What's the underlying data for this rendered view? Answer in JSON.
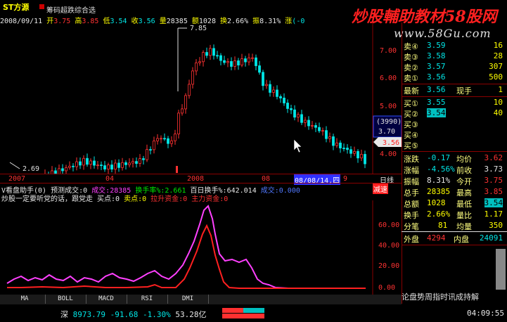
{
  "header": {
    "stock_name": "ST方源",
    "tool": "筹码超跌综合选",
    "watermark": "炒股輔助教材58股网",
    "watermark_url": "www.58Gu.com"
  },
  "info": {
    "date": "2008/09/11",
    "open_lbl": "开",
    "open": "3.75",
    "high_lbl": "高",
    "high": "3.85",
    "low_lbl": "低",
    "low": "3.54",
    "close_lbl": "收",
    "close": "3.56",
    "vol_lbl": "量",
    "vol": "28385",
    "amt_lbl": "额",
    "amt": "1028",
    "turn_lbl": "换",
    "turn": "2.66%",
    "amp_lbl": "振",
    "amp": "8.31%",
    "chg_lbl": "涨",
    "chg": "(-0"
  },
  "main_axis": {
    "ticks": [
      "7.00",
      "6.00",
      "5.00",
      "4.00"
    ],
    "marker": "3.70",
    "marker_top": "(3990)",
    "current": "3.56",
    "peak_label": "7.85",
    "low_label": "2.69",
    "period": "日线"
  },
  "date_axis": [
    "2007",
    "04",
    "2008",
    "08",
    "08/08/14,四",
    "9"
  ],
  "indicator": {
    "line1_a": "V看盘助手(0) 预测成交:0",
    "line1_b": "成交:28385",
    "line1_c": "换手率%:2.661",
    "line1_d": "百日换手%:642.014",
    "line1_e": "成交:0.000",
    "line1_f": "减速",
    "line2_a": "炒股一定要听党的话，跟党走 买点:0",
    "line2_b": "卖点:0",
    "line2_c": "拉升资金:0",
    "line2_d": "主力资金:0",
    "ticks": [
      "60.00",
      "40.00",
      "20.00",
      "0.00"
    ]
  },
  "tabs": [
    "MA",
    "BOLL",
    "MACD",
    "RSI",
    "DMI"
  ],
  "quote": {
    "asks": [
      {
        "label": "卖④",
        "price": "3.59",
        "vol": "16"
      },
      {
        "label": "卖③",
        "price": "3.58",
        "vol": "28"
      },
      {
        "label": "卖②",
        "price": "3.57",
        "vol": "307"
      },
      {
        "label": "卖①",
        "price": "3.56",
        "vol": "500"
      }
    ],
    "last": {
      "label": "最新",
      "price": "3.56",
      "label2": "现手",
      "vol": "1"
    },
    "bids": [
      {
        "label": "买①",
        "price": "3.55",
        "vol": "10"
      },
      {
        "label": "买②",
        "price": "3.54",
        "vol": "40"
      },
      {
        "label": "买③",
        "price": "",
        "vol": ""
      },
      {
        "label": "买④",
        "price": "",
        "vol": ""
      },
      {
        "label": "买⑤",
        "price": "",
        "vol": ""
      }
    ],
    "stats": [
      {
        "l1": "涨跌",
        "v1": "-0.17",
        "l2": "均价",
        "v2": "3.62"
      },
      {
        "l1": "涨幅",
        "v1": "-4.56%",
        "l2": "前收",
        "v2": "3.73"
      },
      {
        "l1": "振幅",
        "v1": "8.31%",
        "l2": "今开",
        "v2": "3.75"
      },
      {
        "l1": "总手",
        "v1": "28385",
        "l2": "最高",
        "v2": "3.85"
      },
      {
        "l1": "总额",
        "v1": "1028",
        "l2": "最低",
        "v2": "3.54"
      },
      {
        "l1": "换手",
        "v1": "2.66%",
        "l2": "量比",
        "v2": "1.17"
      },
      {
        "l1": "分笔",
        "v1": "81",
        "l2": "均量",
        "v2": "350"
      }
    ],
    "outer_lbl": "外盘",
    "outer": "4294",
    "inner_lbl": "内盘",
    "inner": "24091"
  },
  "status": {
    "index_name": "深",
    "index_value": "8973.79",
    "index_chg": "-91.68",
    "index_pct": "-1.30%",
    "index_amt": "53.28亿",
    "clock": "04:09:55",
    "message": "论盘势周指时讯成持解"
  },
  "colors": {
    "up": "#ff3232",
    "down": "#00e6e6",
    "grid": "#8a0000",
    "accent": "#ffff00"
  }
}
